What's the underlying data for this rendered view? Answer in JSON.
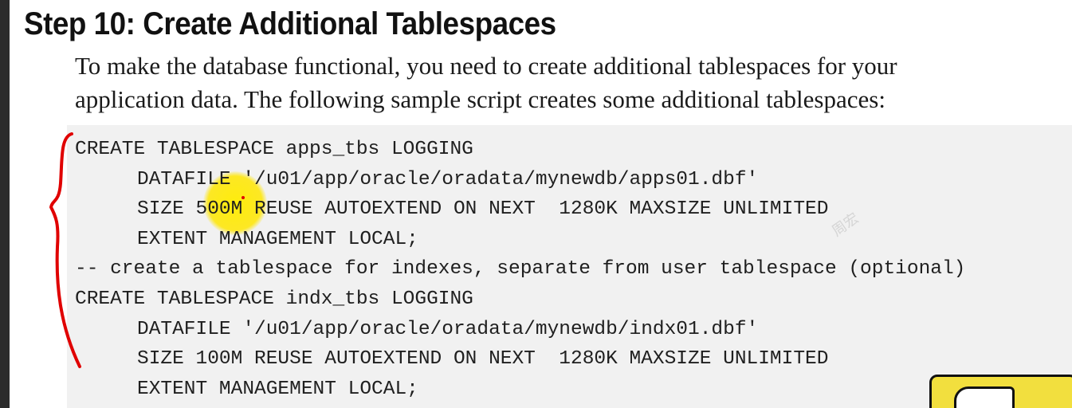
{
  "title": "Step 10: Create Additional Tablespaces",
  "intro": {
    "line1": "To make the database functional, you need to create additional tablespaces for your",
    "line2": "application data. The following sample script creates some additional tablespaces:"
  },
  "code_lines": [
    "CREATE TABLESPACE apps_tbs LOGGING",
    "DATAFILE '/u01/app/oracle/oradata/mynewdb/apps01.dbf'",
    "SIZE 500M REUSE AUTOEXTEND ON NEXT  1280K MAXSIZE UNLIMITED",
    "EXTENT MANAGEMENT LOCAL;",
    "-- create a tablespace for indexes, separate from user tablespace (optional)",
    "CREATE TABLESPACE indx_tbs LOGGING",
    "DATAFILE '/u01/app/oracle/oradata/mynewdb/indx01.dbf'",
    "SIZE 100M REUSE AUTOEXTEND ON NEXT  1280K MAXSIZE UNLIMITED",
    "EXTENT MANAGEMENT LOCAL;"
  ],
  "watermark": "周宏",
  "colors": {
    "annotation": "#e00000",
    "highlight": "#ffec00",
    "code_background": "#f1f1f1"
  }
}
